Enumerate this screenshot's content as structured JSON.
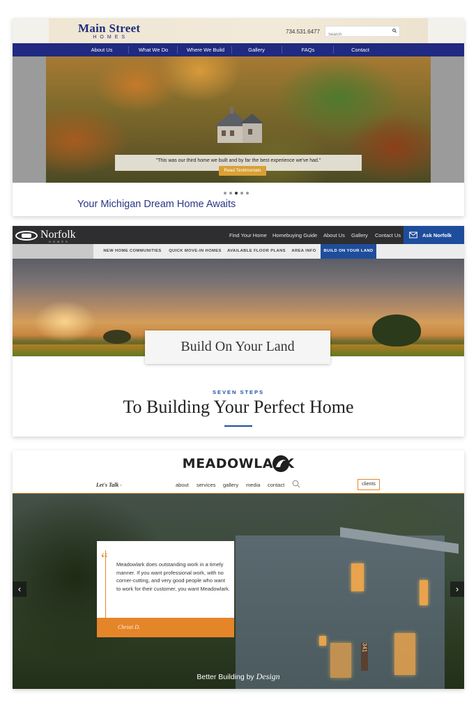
{
  "mainstreet": {
    "logo_line1": "Main Street",
    "logo_line2": "HOMES",
    "phone": "734.531.6477",
    "search_placeholder": "Search",
    "nav": [
      "About Us",
      "What We Do",
      "Where We Build",
      "Gallery",
      "FAQs",
      "Contact"
    ],
    "quote": "\"This was our third home we built and by far the best experience we've had.\"",
    "button": "Read Testimonials",
    "slides_total": 5,
    "slide_active": 3,
    "tagline": "Your Michigan Dream Home Awaits"
  },
  "norfolk": {
    "logo": "Norfolk",
    "logo_sub": "HOMES",
    "top_nav": [
      "Find Your Home",
      "Homebuying Guide",
      "About Us",
      "Gallery",
      "Contact Us"
    ],
    "ask": "Ask Norfolk",
    "sub_nav": [
      "NEW HOME COMMUNITIES",
      "QUICK MOVE-IN HOMES",
      "AVAILABLE FLOOR PLANS",
      "AREA INFO"
    ],
    "sub_nav_active": "BUILD ON YOUR LAND",
    "banner_title": "Build On Your Land",
    "eyebrow": "SEVEN STEPS",
    "heading": "To Building Your Perfect Home",
    "accent": "#1e4d9c"
  },
  "meadowlark": {
    "brand": "MEADOWLARK",
    "lets_talk": "Let's Talk",
    "menu": [
      "about",
      "services",
      "gallery",
      "media",
      "contact"
    ],
    "clients": "clients",
    "testimonial": "Meadowlark does outstanding work in a timely manner. If you want professional work, with no corner-cutting, and very good people who want to work for their customer, you want Meadowlark.",
    "author": "Christi D.",
    "footer_prefix": "Better Building by",
    "footer_em": "Design",
    "house_number": "341",
    "accent": "#e5852a"
  }
}
